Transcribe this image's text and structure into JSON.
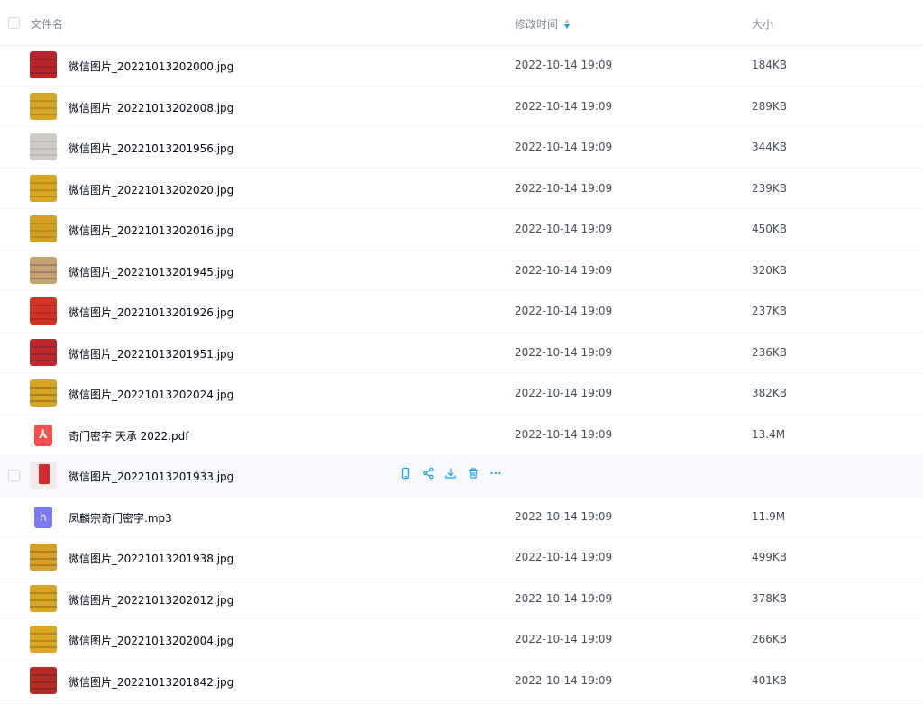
{
  "header": {
    "col_name": "文件名",
    "col_time": "修改时间",
    "col_size": "大小"
  },
  "rows": [
    {
      "name": "微信图片_20221013202000.jpg",
      "time": "2022-10-14 19:09",
      "size": "184KB",
      "type": "image",
      "thumb_color": "#b8262a",
      "thumb_accent": "#5a1a1a"
    },
    {
      "name": "微信图片_20221013202008.jpg",
      "time": "2022-10-14 19:09",
      "size": "289KB",
      "type": "image",
      "thumb_color": "#d6a62a",
      "thumb_accent": "#8a6010"
    },
    {
      "name": "微信图片_20221013201956.jpg",
      "time": "2022-10-14 19:09",
      "size": "344KB",
      "type": "image",
      "thumb_color": "#cfccc7",
      "thumb_accent": "#9c968f"
    },
    {
      "name": "微信图片_20221013202020.jpg",
      "time": "2022-10-14 19:09",
      "size": "239KB",
      "type": "image",
      "thumb_color": "#d9a520",
      "thumb_accent": "#7a5a10"
    },
    {
      "name": "微信图片_20221013202016.jpg",
      "time": "2022-10-14 19:09",
      "size": "450KB",
      "type": "image",
      "thumb_color": "#d4a024",
      "thumb_accent": "#8a6414"
    },
    {
      "name": "微信图片_20221013201945.jpg",
      "time": "2022-10-14 19:09",
      "size": "320KB",
      "type": "image",
      "thumb_color": "#c8a46a",
      "thumb_accent": "#3a4a8a"
    },
    {
      "name": "微信图片_20221013201926.jpg",
      "time": "2022-10-14 19:09",
      "size": "237KB",
      "type": "image",
      "thumb_color": "#d03424",
      "thumb_accent": "#7a1a10"
    },
    {
      "name": "微信图片_20221013201951.jpg",
      "time": "2022-10-14 19:09",
      "size": "236KB",
      "type": "image",
      "thumb_color": "#c0282c",
      "thumb_accent": "#2a2a5a"
    },
    {
      "name": "微信图片_20221013202024.jpg",
      "time": "2022-10-14 19:09",
      "size": "382KB",
      "type": "image",
      "thumb_color": "#d8a428",
      "thumb_accent": "#5a4010"
    },
    {
      "name": "奇门密字 天承 2022.pdf",
      "time": "2022-10-14 19:09",
      "size": "13.4M",
      "type": "pdf"
    },
    {
      "name": "微信图片_20221013201933.jpg",
      "time": "",
      "size": "",
      "type": "image-hover",
      "thumb_color": "#f4e8e8",
      "thumb_accent": "#d02a2a"
    },
    {
      "name": "凤麟宗奇门密字.mp3",
      "time": "2022-10-14 19:09",
      "size": "11.9M",
      "type": "mp3"
    },
    {
      "name": "微信图片_20221013201938.jpg",
      "time": "2022-10-14 19:09",
      "size": "499KB",
      "type": "image",
      "thumb_color": "#d4a02a",
      "thumb_accent": "#7a3a10"
    },
    {
      "name": "微信图片_20221013202012.jpg",
      "time": "2022-10-14 19:09",
      "size": "378KB",
      "type": "image",
      "thumb_color": "#d8a626",
      "thumb_accent": "#6a4a10"
    },
    {
      "name": "微信图片_20221013202004.jpg",
      "time": "2022-10-14 19:09",
      "size": "266KB",
      "type": "image",
      "thumb_color": "#daa822",
      "thumb_accent": "#7a5010"
    },
    {
      "name": "微信图片_20221013201842.jpg",
      "time": "2022-10-14 19:09",
      "size": "401KB",
      "type": "image",
      "thumb_color": "#b82a24",
      "thumb_accent": "#2a2a2a"
    }
  ],
  "hover_actions": [
    {
      "name": "phone-icon"
    },
    {
      "name": "share-icon"
    },
    {
      "name": "download-icon"
    },
    {
      "name": "delete-icon"
    },
    {
      "name": "more-icon"
    }
  ],
  "icons": {
    "pdf_glyph": "⅄",
    "mp3_glyph": "∩"
  },
  "colors": {
    "accent": "#06a7ff",
    "pdf": "#fa4e4e",
    "mp3": "#7b7bf0",
    "hover_row": "#f7f9fc"
  }
}
